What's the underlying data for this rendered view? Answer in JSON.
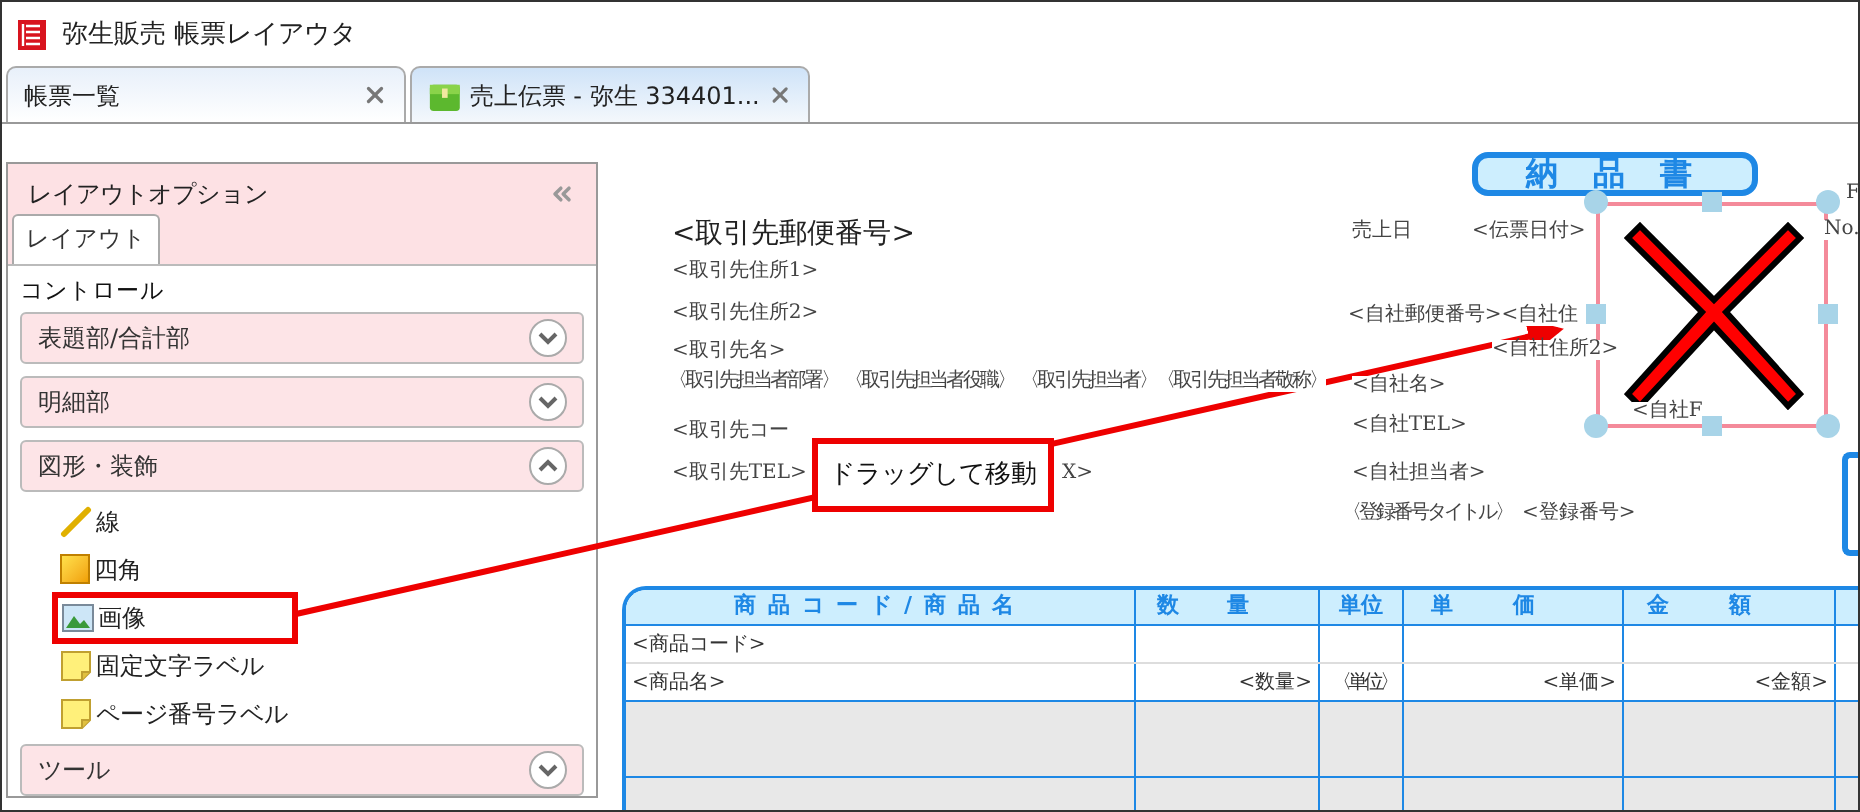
{
  "window": {
    "title": "弥生販売 帳票レイアウタ"
  },
  "tabs": [
    {
      "label": "帳票一覧",
      "selected": false,
      "kind": "list"
    },
    {
      "label": "売上伝票 - 弥生 334401...",
      "selected": true,
      "kind": "document"
    }
  ],
  "layout_options": {
    "title": "レイアウトオプション",
    "tabs": [
      {
        "label": "レイアウト",
        "selected": true
      }
    ],
    "section_label": "コントロール",
    "sections": [
      {
        "label": "表題部/合計部",
        "expanded": false
      },
      {
        "label": "明細部",
        "expanded": false
      },
      {
        "label": "図形・装飾",
        "expanded": true,
        "items": [
          {
            "label": "線",
            "kind": "line",
            "highlighted": false
          },
          {
            "label": "四角",
            "kind": "rectangle",
            "highlighted": false
          },
          {
            "label": "画像",
            "kind": "image",
            "highlighted": true
          },
          {
            "label": "固定文字ラベル",
            "kind": "label",
            "highlighted": false
          },
          {
            "label": "ページ番号ラベル",
            "kind": "label",
            "highlighted": false
          }
        ]
      },
      {
        "label": "ツール",
        "expanded": false
      }
    ]
  },
  "report": {
    "title": "納 品 書",
    "fields": [
      {
        "text": "<取引先郵便番号>",
        "kind": "heading"
      },
      {
        "text": "<取引先住所1>",
        "kind": "field"
      },
      {
        "text": "<取引先住所2>",
        "kind": "field"
      },
      {
        "text": "<取引先名>",
        "kind": "field"
      },
      {
        "text": "〈取引先担当者部署〉",
        "kind": "small"
      },
      {
        "text": "〈取引先担当者役職〉",
        "kind": "small"
      },
      {
        "text": "〈取引先担当者〉",
        "kind": "small"
      },
      {
        "text": "〈取引先担当者敬称〉",
        "kind": "small"
      },
      {
        "text": "<取引先コー",
        "kind": "field"
      },
      {
        "text": "<取引先TEL>",
        "kind": "field"
      },
      {
        "text": "X>",
        "kind": "field"
      },
      {
        "text": "売上日",
        "kind": "field"
      },
      {
        "text": "<伝票日付>",
        "kind": "field"
      },
      {
        "text": "<自社郵便番号><自社住",
        "kind": "field"
      },
      {
        "text": "<自社住所2>",
        "kind": "field"
      },
      {
        "text": "<自社名>",
        "kind": "field"
      },
      {
        "text": "<自社TEL>",
        "kind": "field"
      },
      {
        "text": "<自社F",
        "kind": "field"
      },
      {
        "text": "<自社担当者>",
        "kind": "field"
      },
      {
        "text": "〈登録番号タイトル〉",
        "kind": "small"
      },
      {
        "text": "<登録番号>",
        "kind": "field"
      },
      {
        "text": "F",
        "kind": "field"
      },
      {
        "text": "No.",
        "kind": "field"
      }
    ],
    "image_frame": {
      "selected": true
    },
    "table": {
      "columns": [
        "商品コード/商品名",
        "数量",
        "単位",
        "単価",
        "金額"
      ],
      "rows": [
        [
          "<商品コード>"
        ],
        [
          "<商品名>",
          "<数量>",
          "〈単位〉",
          "<単価>",
          "<金額>"
        ]
      ]
    }
  },
  "annotation": {
    "text": "ドラッグして移動"
  }
}
